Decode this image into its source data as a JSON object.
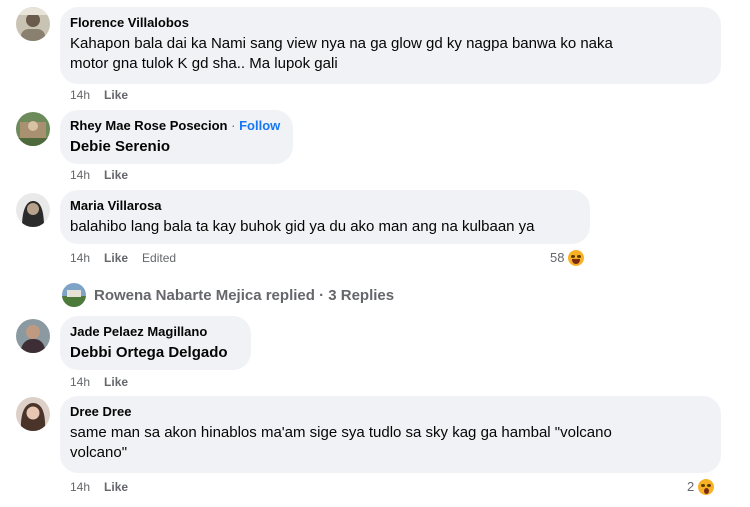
{
  "comments": [
    {
      "author": "Florence Villalobos",
      "text_lines": [
        "Kahapon bala dai ka Nami sang view nya na ga glow gd ky nagpa banwa ko naka",
        "motor gna tulok K gd sha.. Ma lupok gali"
      ],
      "time": "14h",
      "like": "Like"
    },
    {
      "author": "Rhey Mae Rose Posecion",
      "separator": "·",
      "follow": "Follow",
      "text": "Debie Serenio",
      "time": "14h",
      "like": "Like"
    },
    {
      "author": "Maria Villarosa",
      "text": "balahibo lang bala ta kay buhok gid ya du ako man ang na kulbaan ya",
      "time": "14h",
      "like": "Like",
      "edited": "Edited",
      "reactions": {
        "count": "58",
        "icon": "haha-emoji-icon"
      }
    },
    {
      "author": "Jade Pelaez Magillano",
      "text": "Debbi Ortega Delgado",
      "time": "14h",
      "like": "Like"
    },
    {
      "author": "Dree Dree",
      "text_lines": [
        "same man sa akon hinablos ma'am sige sya tudlo sa sky kag ga hambal \"volcano",
        "volcano\""
      ],
      "time": "14h",
      "like": "Like",
      "reactions": {
        "count": "2",
        "icon": "wow-emoji-icon"
      }
    }
  ],
  "replies": {
    "label": "Rowena Nabarte Mejica replied · 3 Replies"
  }
}
